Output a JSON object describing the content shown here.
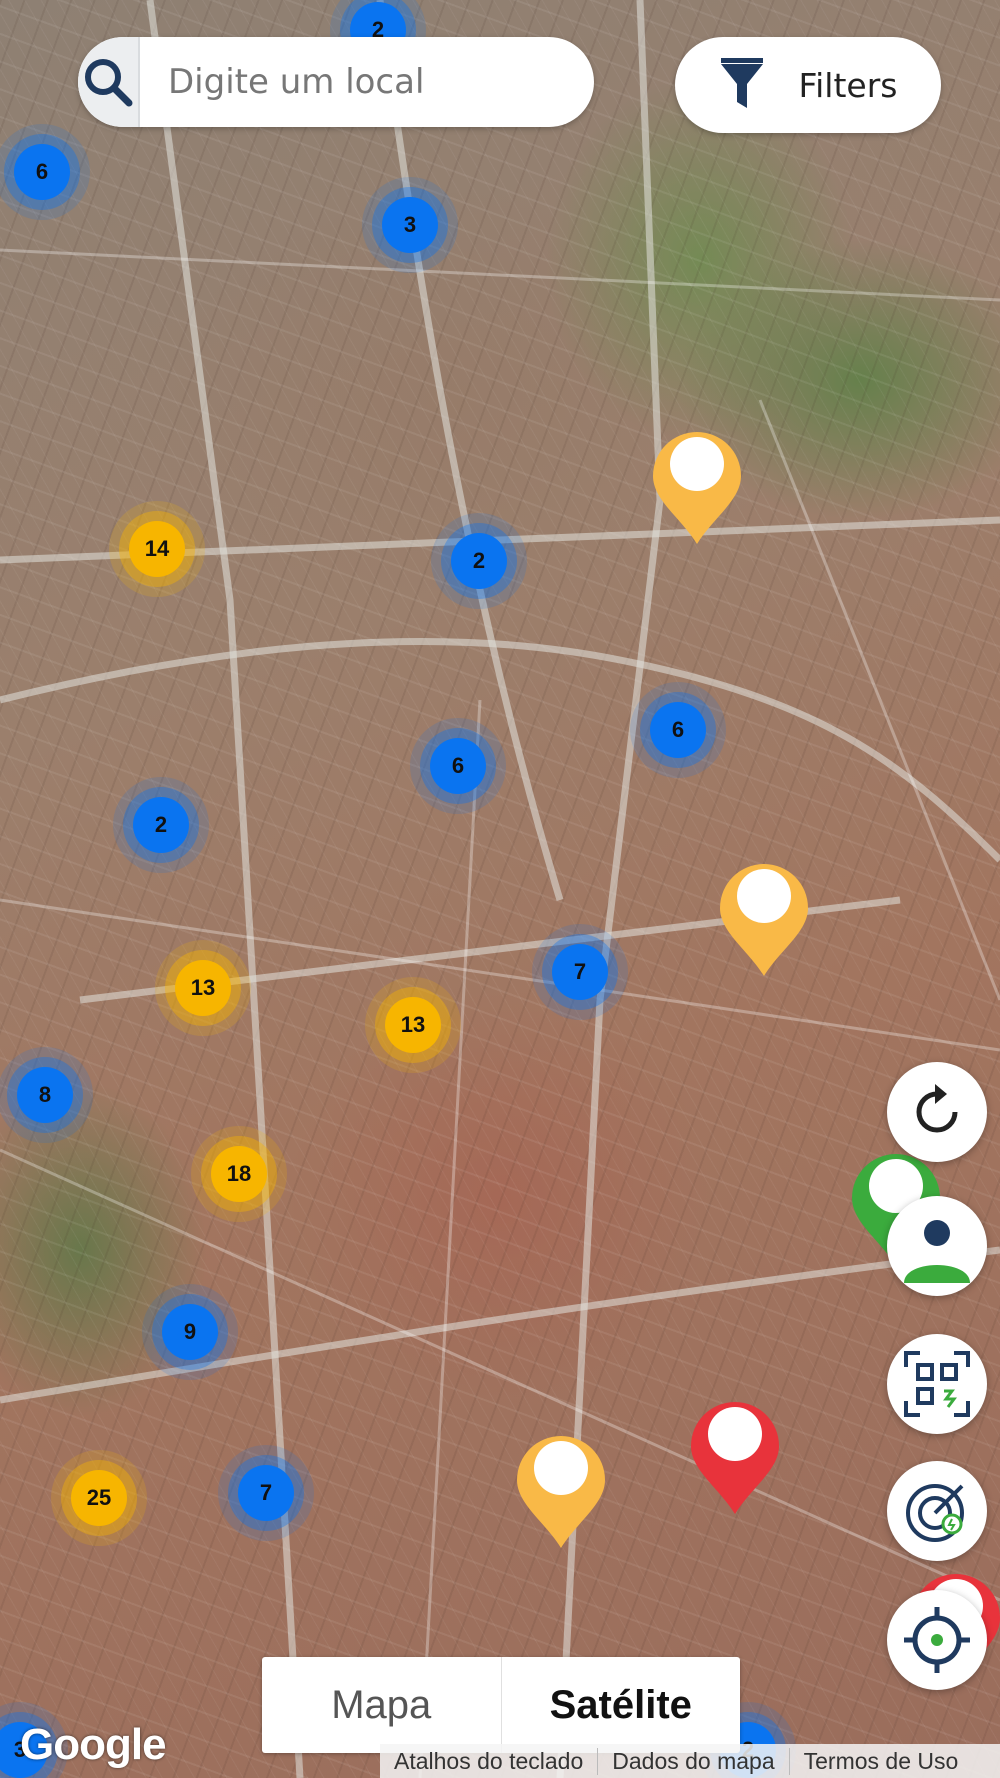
{
  "search": {
    "placeholder": "Digite um local"
  },
  "filters": {
    "label": "Filters"
  },
  "clusters": [
    {
      "count": "2",
      "color": "blue"
    },
    {
      "count": "6",
      "color": "blue"
    },
    {
      "count": "3",
      "color": "blue"
    },
    {
      "count": "14",
      "color": "yellow"
    },
    {
      "count": "2",
      "color": "blue"
    },
    {
      "count": "6",
      "color": "blue"
    },
    {
      "count": "6",
      "color": "blue"
    },
    {
      "count": "2",
      "color": "blue"
    },
    {
      "count": "13",
      "color": "yellow"
    },
    {
      "count": "13",
      "color": "yellow"
    },
    {
      "count": "7",
      "color": "blue"
    },
    {
      "count": "8",
      "color": "blue"
    },
    {
      "count": "18",
      "color": "yellow"
    },
    {
      "count": "9",
      "color": "blue"
    },
    {
      "count": "25",
      "color": "yellow"
    },
    {
      "count": "7",
      "color": "blue"
    },
    {
      "count": "3",
      "color": "blue"
    },
    {
      "count": "2",
      "color": "blue"
    }
  ],
  "pins": [
    {
      "color": "#f9b947"
    },
    {
      "color": "#f9b947"
    },
    {
      "color": "#f9b947"
    },
    {
      "color": "#e8333b"
    },
    {
      "color": "#3bab3d"
    },
    {
      "color": "#e8333b"
    }
  ],
  "controls": {
    "refresh_icon": "refresh-icon",
    "user_icon": "user-location-icon",
    "qr_icon": "qr-scan-icon",
    "charger_icon": "charger-radar-icon",
    "locate_icon": "locate-me-icon"
  },
  "map_type": {
    "map_label": "Mapa",
    "satellite_label": "Satélite",
    "selected": "Satélite"
  },
  "attribution": {
    "logo": "Google",
    "shortcuts": "Atalhos do teclado",
    "map_data": "Dados do mapa",
    "terms": "Termos de Uso"
  },
  "colors": {
    "accent_blue": "#0a74f0",
    "cluster_yellow": "#f7b500",
    "icon_navy": "#1f3a5f"
  }
}
